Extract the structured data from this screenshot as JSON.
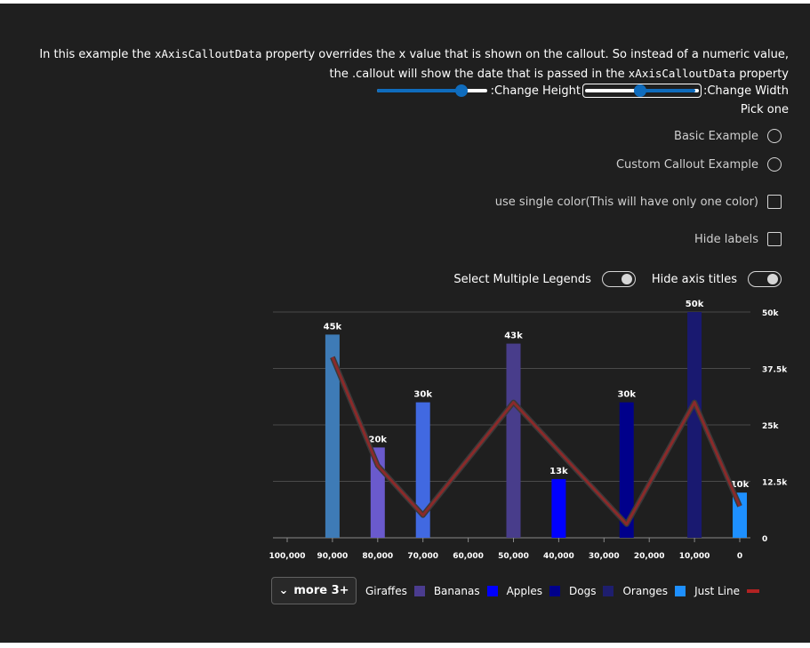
{
  "description": {
    "part1": "In this example the ",
    "code1": "xAxisCalloutData",
    "part2": " property overrides the x value that is shown on the callout. So instead of a numeric value, the .callout will show the date that is passed in the ",
    "code2": "xAxisCalloutData",
    "part3": " property"
  },
  "controls": {
    "height_label": ":Change Height",
    "width_label": ":Change Width",
    "height_value": 0.75,
    "width_value": 0.5
  },
  "pick_label": "Pick one",
  "options": {
    "basic": "Basic Example",
    "custom": "Custom Callout Example",
    "single_color": "use single color(This will have only one color)",
    "hide_labels": "Hide labels"
  },
  "toggles": {
    "multi_legends": "Select Multiple Legends",
    "hide_axis_titles": "Hide axis titles"
  },
  "legend": {
    "more_label": "more 3+",
    "items": [
      {
        "label": "Giraffes",
        "color": "#4b3c8f"
      },
      {
        "label": "Bananas",
        "color": "#0000ff"
      },
      {
        "label": "Apples",
        "color": "#00008b"
      },
      {
        "label": "Dogs",
        "color": "#1e1e6e"
      },
      {
        "label": "Oranges",
        "color": "#1e90ff"
      },
      {
        "label": "Just Line",
        "color": "#b22222",
        "type": "line"
      }
    ]
  },
  "chart_data": {
    "type": "bar",
    "x_ticks": [
      "100,000",
      "90,000",
      "80,000",
      "70,000",
      "60,000",
      "50,000",
      "40,000",
      "30,000",
      "20,000",
      "10,000",
      "0"
    ],
    "y_ticks": [
      "50k",
      "37.5k",
      "25k",
      "12.5k",
      "0"
    ],
    "ylim": [
      0,
      50000
    ],
    "xlim": [
      100000,
      0
    ],
    "bars": [
      {
        "x": 90000,
        "y": 45000,
        "label": "45k",
        "color": "#3e7bb6"
      },
      {
        "x": 80000,
        "y": 20000,
        "label": "20k",
        "color": "#6a5acd"
      },
      {
        "x": 70000,
        "y": 30000,
        "label": "30k",
        "color": "#4169e1"
      },
      {
        "x": 50000,
        "y": 43000,
        "label": "43k",
        "color": "#483d8b"
      },
      {
        "x": 40000,
        "y": 13000,
        "label": "13k",
        "color": "#0000ff"
      },
      {
        "x": 25000,
        "y": 30000,
        "label": "30k",
        "color": "#00008b"
      },
      {
        "x": 10000,
        "y": 50000,
        "label": "50k",
        "color": "#191970"
      },
      {
        "x": 0,
        "y": 10000,
        "label": "10k",
        "color": "#1e90ff"
      }
    ],
    "line": {
      "name": "Just Line",
      "color": "#8b2a2a",
      "points": [
        {
          "x": 90000,
          "y": 40000
        },
        {
          "x": 80000,
          "y": 16000
        },
        {
          "x": 70000,
          "y": 5000
        },
        {
          "x": 50000,
          "y": 30000
        },
        {
          "x": 25000,
          "y": 3000
        },
        {
          "x": 10000,
          "y": 30000
        },
        {
          "x": 0,
          "y": 7000
        }
      ]
    }
  }
}
